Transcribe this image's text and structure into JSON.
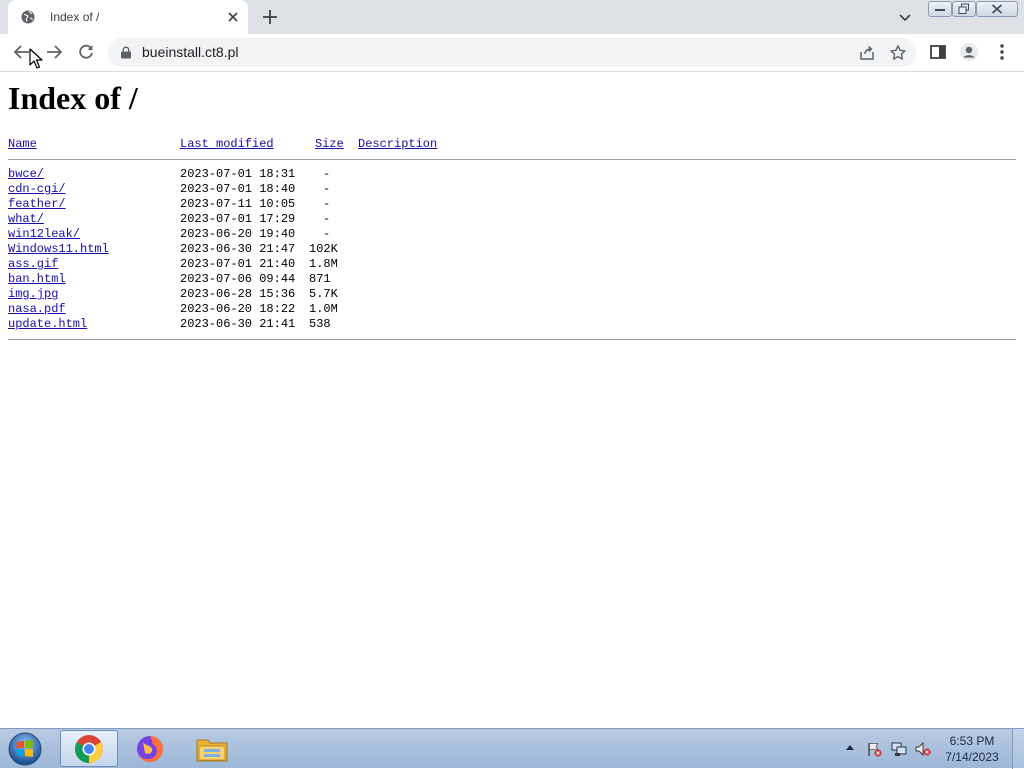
{
  "browser": {
    "tab_title": "Index of /",
    "url": "bueinstall.ct8.pl"
  },
  "page": {
    "heading": "Index of /",
    "columns": {
      "name": "Name",
      "last_modified": "Last modified",
      "size": "Size",
      "description": "Description"
    },
    "entries": [
      {
        "name": "bwce/",
        "modified": "2023-07-01 18:31",
        "size": "-"
      },
      {
        "name": "cdn-cgi/",
        "modified": "2023-07-01 18:40",
        "size": "-"
      },
      {
        "name": "feather/",
        "modified": "2023-07-11 10:05",
        "size": "-"
      },
      {
        "name": "what/",
        "modified": "2023-07-01 17:29",
        "size": "-"
      },
      {
        "name": "win12leak/",
        "modified": "2023-06-20 19:40",
        "size": "-"
      },
      {
        "name": "Windows11.html",
        "modified": "2023-06-30 21:47",
        "size": "102K"
      },
      {
        "name": "ass.gif",
        "modified": "2023-07-01 21:40",
        "size": "1.8M"
      },
      {
        "name": "ban.html",
        "modified": "2023-07-06 09:44",
        "size": "871"
      },
      {
        "name": "img.jpg",
        "modified": "2023-06-28 15:36",
        "size": "5.7K"
      },
      {
        "name": "nasa.pdf",
        "modified": "2023-06-20 18:22",
        "size": "1.0M"
      },
      {
        "name": "update.html",
        "modified": "2023-06-30 21:41",
        "size": "538"
      }
    ]
  },
  "taskbar": {
    "apps": [
      "chrome-icon",
      "firefox-icon",
      "file-explorer-icon"
    ],
    "time": "6:53 PM",
    "date": "7/14/2023"
  },
  "colors": {
    "link": "#1a0dab",
    "tabstrip": "#dee1e6",
    "taskbar": "#a8c0dd"
  }
}
